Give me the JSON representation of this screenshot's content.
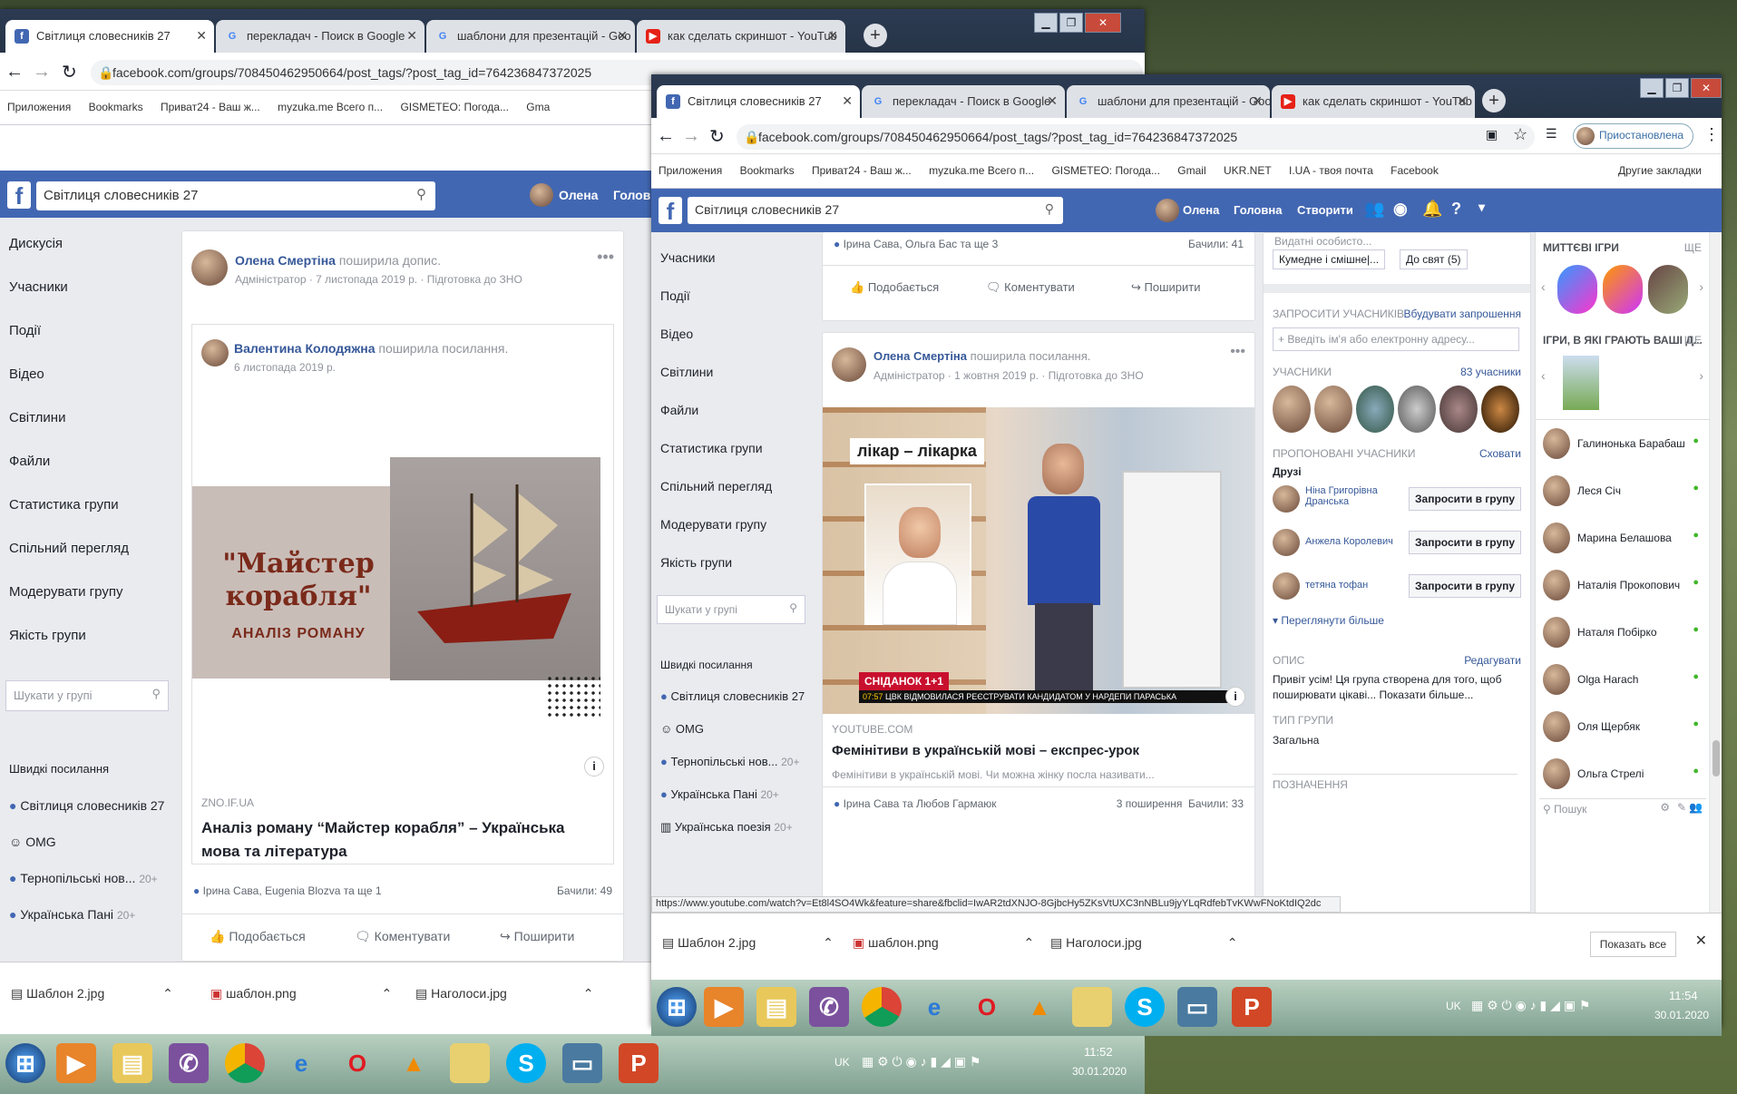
{
  "back": {
    "tabs": [
      {
        "label": "Світлиця словесників 27",
        "icon": "f"
      },
      {
        "label": "перекладач - Поиск в Google",
        "icon": "G"
      },
      {
        "label": "шаблони для презентацій - Goo",
        "icon": "G"
      },
      {
        "label": "как сделать скриншот - YouTub",
        "icon": "▶"
      }
    ],
    "url": "facebook.com/groups/708450462950664/post_tags/?post_tag_id=764236847372025",
    "bookmarks": [
      "Приложения",
      "Bookmarks",
      "Приват24 - Ваш ж...",
      "myzuka.me Всего п...",
      "GISMETEO: Погода...",
      "Gma"
    ],
    "search": "Світлиця словесників 27",
    "user": "Олена",
    "home": "Головн",
    "sidebar": [
      "Дискусія",
      "Учасники",
      "Події",
      "Відео",
      "Світлини",
      "Файли",
      "Статистика групи",
      "Спільний перегляд",
      "Модерувати групу",
      "Якість групи"
    ],
    "side_search": "Шукати у групі",
    "shortcuts_title": "Швидкі посилання",
    "shortcuts": [
      {
        "label": "Світлиця словесників 27",
        "badge": ""
      },
      {
        "label": "OMG",
        "badge": ""
      },
      {
        "label": "Тернопільські нов...",
        "badge": "20+"
      },
      {
        "label": "Українська Пані",
        "badge": "20+"
      }
    ],
    "post": {
      "author": "Олена Смертіна",
      "action": "поширила допис.",
      "meta": "Адміністратор · 7 листопада 2019 р. · Підготовка до ЗНО",
      "inner_author": "Валентина Колодяжна",
      "inner_action": "поширила посилання.",
      "inner_date": "6 листопада 2019 р.",
      "image_title": "\"Майстер корабля\"",
      "image_sub": "АНАЛІЗ РОМАНУ",
      "domain": "ZNO.IF.UA",
      "link_title": "Аналіз роману “Майстер корабля” – Українська мова та література",
      "reactions": "Ірина Сава, Eugenia Blozva та ще 1",
      "seen": "Бачили: 49",
      "like": "Подобається",
      "comment": "Коментувати",
      "share": "Поширити"
    },
    "downloads": [
      "Шаблон 2.jpg",
      "шаблон.png",
      "Наголоси.jpg"
    ],
    "clock": {
      "time": "11:52",
      "date": "30.01.2020"
    },
    "tray_lang": "UK"
  },
  "front": {
    "tabs": [
      {
        "label": "Світлиця словесників 27",
        "icon": "f"
      },
      {
        "label": "перекладач - Поиск в Google",
        "icon": "G"
      },
      {
        "label": "шаблони для презентацій - Goo",
        "icon": "G"
      },
      {
        "label": "как сделать скриншот - YouTub",
        "icon": "▶"
      }
    ],
    "url": "facebook.com/groups/708450462950664/post_tags/?post_tag_id=764236847372025",
    "profile": "Приостановлена",
    "bookmarks": [
      "Приложения",
      "Bookmarks",
      "Приват24 - Ваш ж...",
      "myzuka.me Всего п...",
      "GISMETEO: Погода...",
      "Gmail",
      "UKR.NET",
      "I.UA - твоя почта",
      "Facebook"
    ],
    "other_bookmarks": "Другие закладки",
    "search": "Світлиця словесників 27",
    "user": "Олена",
    "home": "Головна",
    "create": "Створити",
    "sidebar": [
      "Учасники",
      "Події",
      "Відео",
      "Світлини",
      "Файли",
      "Статистика групи",
      "Спільний перегляд",
      "Модерувати групу",
      "Якість групи"
    ],
    "side_search": "Шукати у групі",
    "shortcuts_title": "Швидкі посилання",
    "shortcuts": [
      {
        "label": "Світлиця словесників 27",
        "badge": ""
      },
      {
        "label": "OMG",
        "badge": ""
      },
      {
        "label": "Тернопільські нов...",
        "badge": "20+"
      },
      {
        "label": "Українська Пані",
        "badge": "20+"
      },
      {
        "label": "Українська поезія",
        "badge": "20+"
      }
    ],
    "prev_reactions": "Ірина Сава, Ольга Бас та ще 3",
    "prev_seen": "Бачили: 41",
    "like": "Подобається",
    "comment": "Коментувати",
    "share": "Поширити",
    "post": {
      "author": "Олена Смертіна",
      "action": "поширила посилання.",
      "meta": "Адміністратор · 1 жовтня 2019 р. · Підготовка до ЗНО",
      "image_label": "лікар – лікарка",
      "tv_banner": "СНІДАНОК 1+1",
      "tv_ticker": "ЦВК ВІДМОВИЛАСЯ РЕЄСТРУВАТИ КАНДИДАТОМ У НАРДЕПИ ПАРАСЬКА",
      "tv_time": "07:57",
      "domain": "YOUTUBE.COM",
      "link_title": "Фемінітиви в українській мові – експрес-урок",
      "link_desc": "Фемінітиви в українській мові. Чи можна жінку посла називати...",
      "reactions": "Ірина Сава та Любов Гармаюк",
      "stats": "3 поширення  Бачили: 33"
    },
    "right": {
      "chips": [
        "Кумедне і смішне|...",
        "До свят (5)"
      ],
      "top_cut": "Видатні особисто...",
      "invite_title": "ЗАПРОСИТИ УЧАСНИКІВ",
      "invite_link": "Вбудувати запрошення",
      "invite_placeholder": "+ Введіть ім'я або електронну адресу...",
      "members_title": "УЧАСНИКИ",
      "members_count": "83 учасники",
      "suggested_title": "ПРОПОНОВАНІ УЧАСНИКИ",
      "suggested_hide": "Сховати",
      "friends": "Друзі",
      "suggested": [
        "Ніна Григорівна Дранська",
        "Анжела Королевич",
        "тетяна тофан"
      ],
      "invite_btn": "Запросити в групу",
      "more": "Переглянути більше",
      "desc_title": "ОПИС",
      "desc_edit": "Редагувати",
      "desc_text": "Привіт усім! Ця група створена для того, щоб поширювати цікаві... Показати більше...",
      "type_title": "ТИП ГРУПИ",
      "type_value": "Загальна",
      "cut_bottom": "ПОЗНАЧЕННЯ"
    },
    "chat": {
      "games_title": "МИТТЄВІ ІГРИ",
      "games_more": "ЩЕ",
      "friends_games": "ІГРИ, В ЯКІ ГРАЮТЬ ВАШІ Д...",
      "friends_more": "ЩЕ",
      "contacts": [
        "Галинонька Барабаш",
        "Леся Січ",
        "Марина Белашова",
        "Наталія Прокопович",
        "Наталя Побірко",
        "Olga Harach",
        "Оля Щербяк",
        "Ольга Стрелі"
      ],
      "search": "Пошук"
    },
    "status_url": "https://www.youtube.com/watch?v=Et8l4SO4Wk&feature=share&fbclid=IwAR2tdXNJO-8GjbcHy5ZKsVtUXC3nNBLu9jyYLqRdfebTvKWwFNoKtdIQ2dc",
    "downloads": [
      "Шаблон 2.jpg",
      "шаблон.png",
      "Наголоси.jpg"
    ],
    "show_all": "Показать все",
    "clock": {
      "time": "11:54",
      "date": "30.01.2020"
    },
    "tray_lang": "UK"
  }
}
